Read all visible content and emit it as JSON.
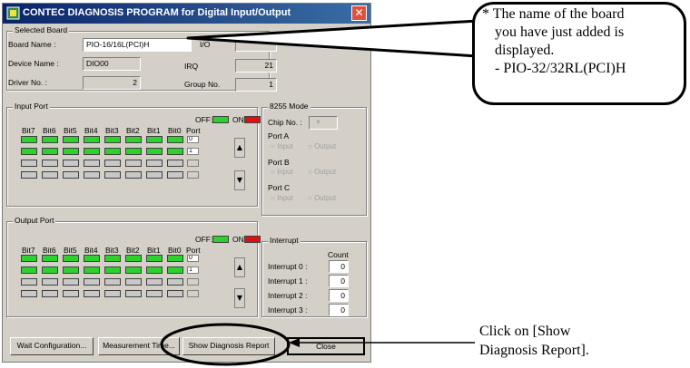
{
  "window": {
    "title": "CONTEC DIAGNOSIS PROGRAM for Digital Input/Output",
    "close_symbol": "✕"
  },
  "selected_board": {
    "group_label": "Selected Board",
    "board_name_label": "Board Name :",
    "board_name_value": "PIO-16/16L(PCI)H",
    "io_label": "I/O",
    "device_name_label": "Device Name :",
    "device_name_value": "DIO00",
    "irq_label": "IRQ",
    "irq_value": "21",
    "driver_no_label": "Driver No. :",
    "driver_no_value": "2",
    "group_no_label": "Group No.",
    "group_no_value": "1"
  },
  "input_port": {
    "group_label": "Input Port",
    "off_label": "OFF:",
    "on_label": "ON:",
    "bit_headers": [
      "Bit7",
      "Bit6",
      "Bit5",
      "Bit4",
      "Bit3",
      "Bit2",
      "Bit1",
      "Bit0"
    ],
    "port_header": "Port",
    "rows": [
      {
        "leds": [
          "on",
          "on",
          "on",
          "on",
          "on",
          "on",
          "on",
          "on"
        ],
        "port": "0",
        "enabled": true
      },
      {
        "leds": [
          "on",
          "on",
          "on",
          "on",
          "on",
          "on",
          "on",
          "on"
        ],
        "port": "1",
        "enabled": true
      },
      {
        "leds": [
          "off",
          "off",
          "off",
          "off",
          "off",
          "off",
          "off",
          "off"
        ],
        "port": "",
        "enabled": false
      },
      {
        "leds": [
          "off",
          "off",
          "off",
          "off",
          "off",
          "off",
          "off",
          "off"
        ],
        "port": "",
        "enabled": false
      }
    ]
  },
  "output_port": {
    "group_label": "Output Port",
    "off_label": "OFF:",
    "on_label": "ON:",
    "bit_headers": [
      "Bit7",
      "Bit6",
      "Bit5",
      "Bit4",
      "Bit3",
      "Bit2",
      "Bit1",
      "Bit0"
    ],
    "port_header": "Port",
    "rows": [
      {
        "leds": [
          "on",
          "on",
          "on",
          "on",
          "on",
          "on",
          "on",
          "on"
        ],
        "port": "0",
        "enabled": true
      },
      {
        "leds": [
          "on",
          "on",
          "on",
          "on",
          "on",
          "on",
          "on",
          "on"
        ],
        "port": "1",
        "enabled": true
      },
      {
        "leds": [
          "off",
          "off",
          "off",
          "off",
          "off",
          "off",
          "off",
          "off"
        ],
        "port": "",
        "enabled": false
      },
      {
        "leds": [
          "off",
          "off",
          "off",
          "off",
          "off",
          "off",
          "off",
          "off"
        ],
        "port": "",
        "enabled": false
      }
    ]
  },
  "mode_8255": {
    "group_label": "8255 Mode",
    "chip_no_label": "Chip No. :",
    "port_a_label": "Port A",
    "port_b_label": "Port B",
    "port_c_label": "Port C",
    "input_option": "Input",
    "output_option": "Output"
  },
  "interrupt": {
    "group_label": "Interrupt",
    "count_header": "Count",
    "items": [
      {
        "label": "Interrupt 0 :",
        "count": "0"
      },
      {
        "label": "Interrupt 1 :",
        "count": "0"
      },
      {
        "label": "Interrupt 2 :",
        "count": "0"
      },
      {
        "label": "Interrupt 3 :",
        "count": "0"
      }
    ]
  },
  "buttons": {
    "wait_configuration": "Wait Configuration...",
    "measurement_time": "Measurement Time...",
    "show_diagnosis_report": "Show Diagnosis Report",
    "close": "Close"
  },
  "annotations": {
    "callout_lines": [
      "* The name of the board",
      "you have just added is",
      "displayed.",
      "- PIO-32/32RL(PCI)H"
    ],
    "note_lines": [
      "Click on [Show",
      "Diagnosis Report]."
    ]
  },
  "colors": {
    "led_on": "#2ed02e",
    "led_off": "#c8c8c8",
    "led_indicator_on": "#e01010",
    "titlebar": "#0a246a",
    "dialog_face": "#d4d0c8"
  }
}
